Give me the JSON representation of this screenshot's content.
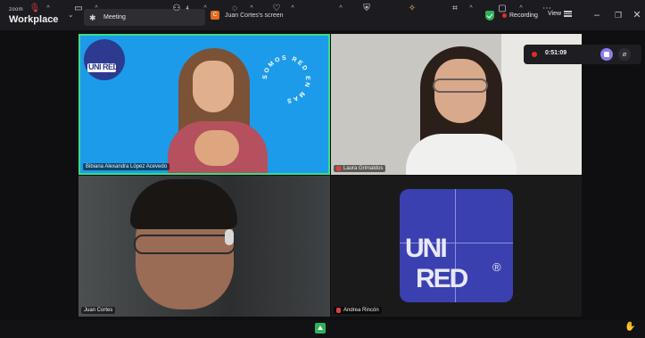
{
  "app": {
    "brand_small": "zoom",
    "brand_name": "Workplace"
  },
  "tabs": {
    "meeting_label": "Meeting",
    "share_label": "Juan Cortes's screen",
    "share_initial": "C"
  },
  "status": {
    "recording_label": "Recording",
    "view_label": "View"
  },
  "recording_widget": {
    "time": "0:51:09"
  },
  "participants": [
    {
      "name": "Bibiana Alexandra López Acevedo",
      "muted": false,
      "active_speaker": true
    },
    {
      "name": "Laura Grimaldos",
      "muted": true,
      "active_speaker": false
    },
    {
      "name": "Juan Cortes",
      "muted": false,
      "active_speaker": false
    },
    {
      "name": "Andrea Rincón",
      "muted": true,
      "active_speaker": false
    }
  ],
  "tile1": {
    "logo_text": "UNI RED",
    "ring_text": "SOMOS RED EN MAS"
  },
  "tile4": {
    "logo_line1": "UNI",
    "logo_line2": "RED",
    "reg_mark": "®"
  },
  "toolbar": {
    "participants_count": "4"
  },
  "colors": {
    "accent_green": "#2fb15a",
    "recording_red": "#e02b2b",
    "active_border": "#3ddc84",
    "brand_blue": "#2c3a8f"
  }
}
